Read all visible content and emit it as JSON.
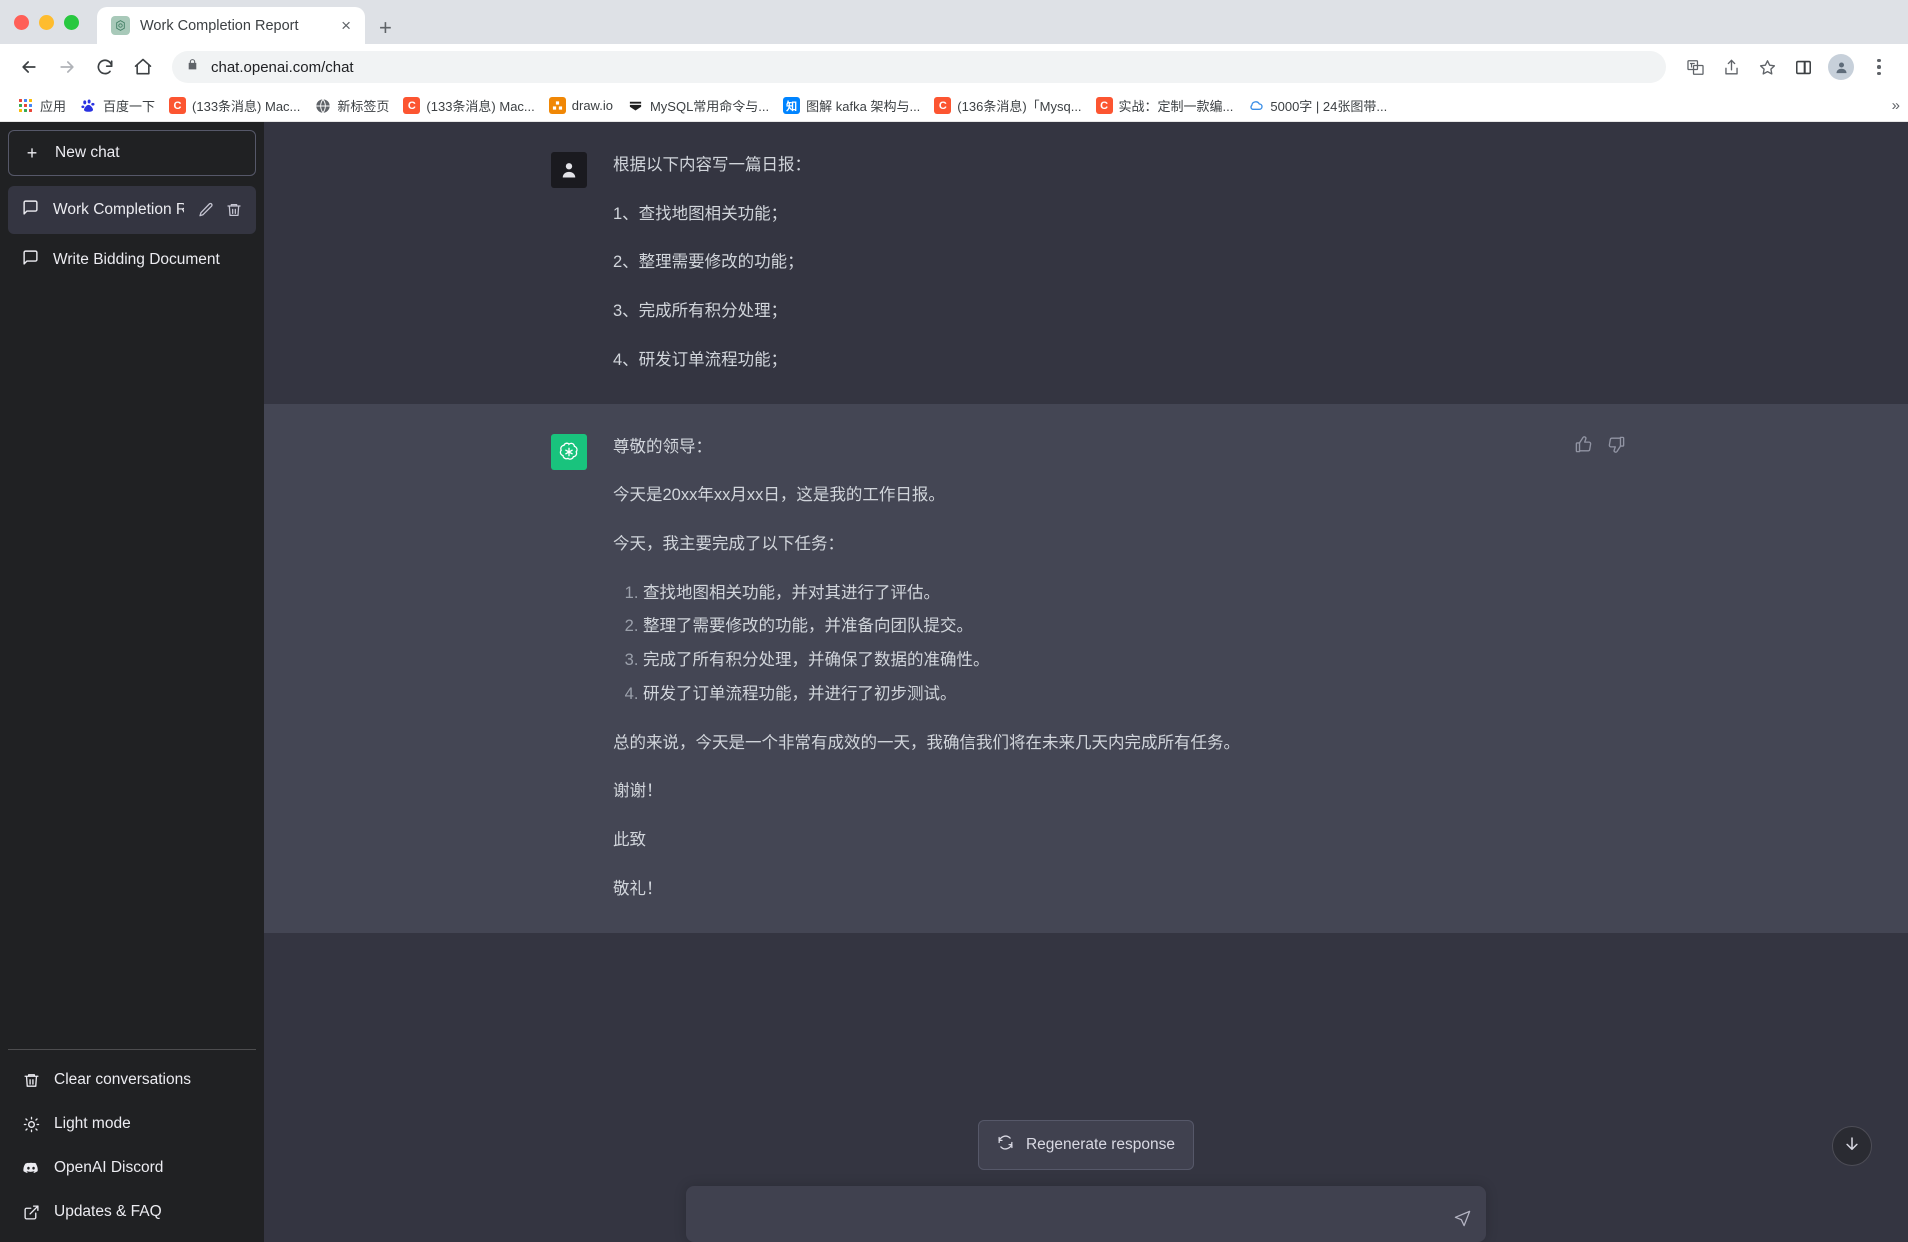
{
  "browser": {
    "tab": {
      "title": "Work Completion Report",
      "favicon": "openai-logo-icon",
      "close_label": "×"
    },
    "new_tab_label": "+",
    "url": "chat.openai.com/chat",
    "nav": {
      "back": "←",
      "forward": "→",
      "reload": "⟳",
      "home": "⌂"
    },
    "bookmarks": [
      {
        "label": "应用",
        "icon": "apps-grid-icon",
        "color": "#4285f4"
      },
      {
        "label": "百度一下",
        "icon": "baidu-icon",
        "color": "#2932e1"
      },
      {
        "label": "(133条消息) Mac...",
        "icon": "csdn-icon",
        "color": "#fc5531",
        "glyph": "C"
      },
      {
        "label": "新标签页",
        "icon": "globe-icon",
        "color": "#5f6368"
      },
      {
        "label": "(133条消息) Mac...",
        "icon": "csdn-icon",
        "color": "#fc5531",
        "glyph": "C"
      },
      {
        "label": "draw.io",
        "icon": "drawio-icon",
        "color": "#f08705"
      },
      {
        "label": "MySQL常用命令与...",
        "icon": "juejin-icon",
        "color": "#1e80ff"
      },
      {
        "label": "图解 kafka 架构与...",
        "icon": "zhihu-icon",
        "color": "#0084ff",
        "glyph": "知"
      },
      {
        "label": "(136条消息)「Mysq...",
        "icon": "csdn-icon",
        "color": "#fc5531",
        "glyph": "C"
      },
      {
        "label": "实战：定制一款编...",
        "icon": "csdn-icon",
        "color": "#fc5531",
        "glyph": "C"
      },
      {
        "label": "5000字 | 24张图带...",
        "icon": "cloud-icon",
        "color": "#3a8ee6"
      }
    ],
    "bookmarks_overflow": "»",
    "toolbar_right": [
      {
        "icon": "translate-icon"
      },
      {
        "icon": "share-icon"
      },
      {
        "icon": "bookmark-star-icon"
      },
      {
        "icon": "sidepanel-icon"
      },
      {
        "icon": "profile-avatar-icon"
      },
      {
        "icon": "kebab-menu-icon"
      }
    ]
  },
  "sidebar": {
    "new_chat": {
      "label": "New chat",
      "icon": "plus-icon"
    },
    "conversations": [
      {
        "label": "Work Completion Rep",
        "icon": "chat-bubble-icon",
        "active": true,
        "edit_icon": "pencil-icon",
        "delete_icon": "trash-icon"
      },
      {
        "label": "Write Bidding Document",
        "icon": "chat-bubble-icon",
        "active": false
      }
    ],
    "footer": [
      {
        "label": "Clear conversations",
        "icon": "trash-icon"
      },
      {
        "label": "Light mode",
        "icon": "sun-icon"
      },
      {
        "label": "OpenAI Discord",
        "icon": "discord-icon"
      },
      {
        "label": "Updates & FAQ",
        "icon": "external-link-icon"
      }
    ]
  },
  "conversation": {
    "user_message": {
      "avatar": "user-avatar-icon",
      "paragraphs": [
        "根据以下内容写一篇日报：",
        "1、查找地图相关功能；",
        "2、整理需要修改的功能；",
        "3、完成所有积分处理；",
        "4、研发订单流程功能；"
      ]
    },
    "assistant_message": {
      "avatar": "openai-logo-icon",
      "greeting": "尊敬的领导：",
      "intro": "今天是20xx年xx月xx日，这是我的工作日报。",
      "lead_in": "今天，我主要完成了以下任务：",
      "tasks": [
        "查找地图相关功能，并对其进行了评估。",
        "整理了需要修改的功能，并准备向团队提交。",
        "完成了所有积分处理，并确保了数据的准确性。",
        "研发了订单流程功能，并进行了初步测试。"
      ],
      "summary": "总的来说，今天是一个非常有成效的一天，我确信我们将在未来几天内完成所有任务。",
      "thanks": "谢谢！",
      "sign_off_1": "此致",
      "sign_off_2": "敬礼！",
      "actions": {
        "thumbs_up": "thumbs-up-icon",
        "thumbs_down": "thumbs-down-icon"
      }
    }
  },
  "composer": {
    "regenerate_label": "Regenerate response",
    "regenerate_icon": "refresh-icon",
    "input_value": "",
    "input_placeholder": "",
    "send_icon": "send-icon",
    "scroll_bottom_icon": "arrow-down-icon"
  },
  "colors": {
    "sidebar_bg": "#202123",
    "user_msg_bg": "#343541",
    "assistant_msg_bg": "#444654",
    "accent_green": "#19c37d",
    "text_primary": "#d1d5db"
  }
}
